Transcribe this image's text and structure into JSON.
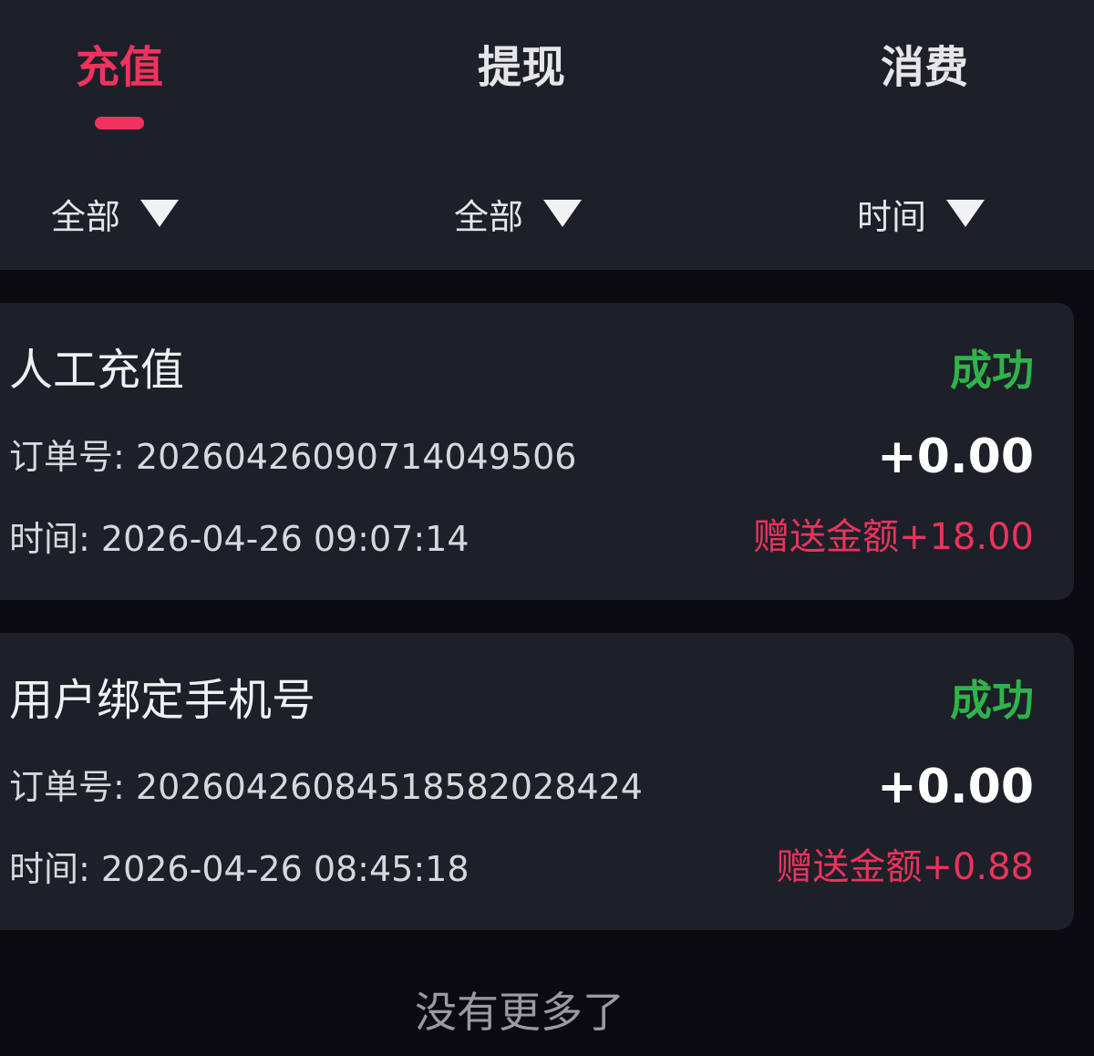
{
  "tabs": [
    {
      "label": "充值",
      "active": true
    },
    {
      "label": "提现",
      "active": false
    },
    {
      "label": "消费",
      "active": false
    }
  ],
  "filters": [
    {
      "label": "全部",
      "icon": "triangle-down-icon"
    },
    {
      "label": "全部",
      "icon": "triangle-down-icon"
    },
    {
      "label": "时间",
      "icon": "triangle-down-icon"
    }
  ],
  "records": [
    {
      "title": "人工充值",
      "status": "成功",
      "order_label": "订单号:",
      "order_no": "20260426090714049506",
      "time_label": "时间:",
      "time": "2026-04-26 09:07:14",
      "amount": "+0.00",
      "bonus": "赠送金额+18.00"
    },
    {
      "title": "用户绑定手机号",
      "status": "成功",
      "order_label": "订单号:",
      "order_no": "2026042608451858202842​4",
      "time_label": "时间:",
      "time": "2026-04-26 08:45:18",
      "amount": "+0.00",
      "bonus": "赠送金额+0.88"
    }
  ],
  "footer": {
    "text": "没有更多了"
  },
  "colors": {
    "accent": "#f1325e",
    "success": "#2fb34a",
    "bonus": "#e9345c",
    "card_bg": "#1d1f29",
    "page_bg": "#0b0b0f"
  }
}
